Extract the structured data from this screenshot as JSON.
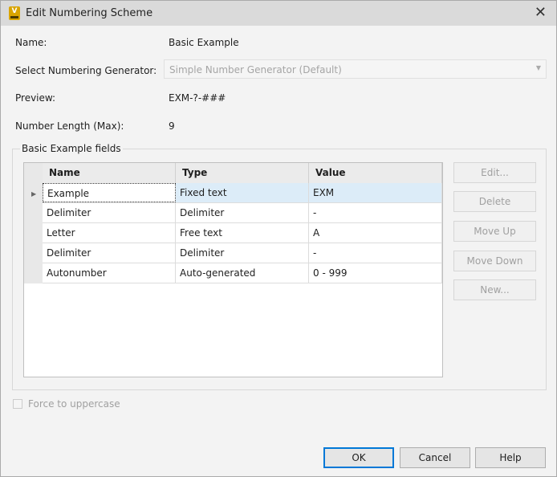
{
  "window": {
    "title": "Edit Numbering Scheme",
    "icon_letter": "V"
  },
  "form": {
    "name_label": "Name:",
    "name_value": "Basic Example",
    "generator_label": "Select Numbering Generator:",
    "generator_value": "Simple Number Generator (Default)",
    "preview_label": "Preview:",
    "preview_value": "EXM-?-###",
    "length_label": "Number Length (Max):",
    "length_value": "9"
  },
  "fields": {
    "group_label": "Basic Example fields",
    "columns": [
      "Name",
      "Type",
      "Value"
    ],
    "rows": [
      {
        "name": "Example",
        "type": "Fixed text",
        "value": "EXM"
      },
      {
        "name": "Delimiter",
        "type": "Delimiter",
        "value": "-"
      },
      {
        "name": "Letter",
        "type": "Free text",
        "value": "A"
      },
      {
        "name": "Delimiter",
        "type": "Delimiter",
        "value": "-"
      },
      {
        "name": "Autonumber",
        "type": "Auto-generated",
        "value": "0 - 999"
      }
    ],
    "buttons": {
      "edit": "Edit...",
      "delete": "Delete",
      "move_up": "Move Up",
      "move_down": "Move Down",
      "new": "New..."
    }
  },
  "force_uppercase": {
    "label": "Force to uppercase",
    "checked": false
  },
  "footer": {
    "ok": "OK",
    "cancel": "Cancel",
    "help": "Help"
  }
}
